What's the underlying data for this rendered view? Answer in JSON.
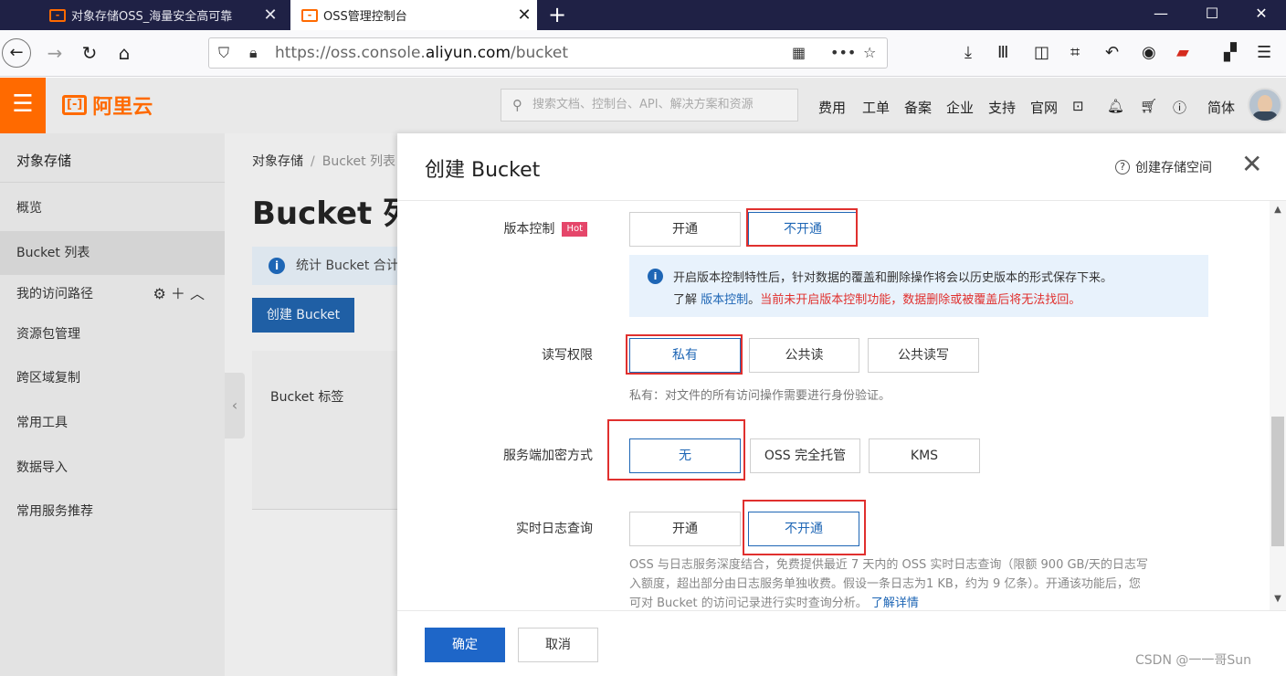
{
  "browser": {
    "tabs": [
      {
        "title": "对象存储OSS_海量安全高可靠",
        "active": false
      },
      {
        "title": "OSS管理控制台",
        "active": true
      }
    ],
    "new_tab": "+",
    "url_prefix": "https://oss.console.",
    "url_domain": "aliyun.com",
    "url_path": "/bucket",
    "window_controls": {
      "minimize": "—",
      "maximize": "☐",
      "close": "✕"
    }
  },
  "console": {
    "logo_text": "阿里云",
    "logo_mark": "[-]",
    "search_placeholder": "搜索文档、控制台、API、解决方案和资源",
    "links": [
      "费用",
      "工单",
      "备案",
      "企业",
      "支持",
      "官网"
    ],
    "lang": "简体"
  },
  "sidebar": {
    "title": "对象存储",
    "items": [
      {
        "label": "概览"
      },
      {
        "label": "Bucket 列表",
        "selected": true
      },
      {
        "label": "我的访问路径"
      },
      {
        "label": "资源包管理"
      },
      {
        "label": "跨区域复制"
      },
      {
        "label": "常用工具"
      },
      {
        "label": "数据导入"
      },
      {
        "label": "常用服务推荐"
      }
    ]
  },
  "main": {
    "breadcrumb": [
      "对象存储",
      "Bucket 列表"
    ],
    "page_title": "Bucket 列表",
    "stats_banner": "统计 Bucket 合计",
    "create_button": "创建 Bucket",
    "tag_label": "Bucket 标签"
  },
  "dialog": {
    "title": "创建 Bucket",
    "help_link": "创建存储空间",
    "versioning": {
      "label": "版本控制",
      "badge": "Hot",
      "options": [
        "开通",
        "不开通"
      ],
      "selected": "不开通",
      "notice_line1": "开启版本控制特性后，针对数据的覆盖和删除操作将会以历史版本的形式保存下来。",
      "notice_learn": "了解",
      "notice_link": "版本控制",
      "notice_warning": "当前未开启版本控制功能，数据删除或被覆盖后将无法找回。"
    },
    "acl": {
      "label": "读写权限",
      "options": [
        "私有",
        "公共读",
        "公共读写"
      ],
      "selected": "私有",
      "hint": "私有：对文件的所有访问操作需要进行身份验证。"
    },
    "encryption": {
      "label": "服务端加密方式",
      "options": [
        "无",
        "OSS 完全托管",
        "KMS"
      ],
      "selected": "无"
    },
    "realtime_log": {
      "label": "实时日志查询",
      "options": [
        "开通",
        "不开通"
      ],
      "selected": "不开通",
      "desc_line1": "OSS 与日志服务深度结合，免费提供最近 7 天内的 OSS 实时日志查询（限额 900 GB/天的日志写",
      "desc_line2": "入额度，超出部分由日志服务单独收费。假设一条日志为1 KB，约为 9 亿条）。开通该功能后，您",
      "desc_line3": "可对 Bucket 的访问记录进行实时查询分析。",
      "desc_link": "了解详情"
    },
    "ok_button": "确定",
    "cancel_button": "取消"
  },
  "watermark": "CSDN @一一哥Sun"
}
